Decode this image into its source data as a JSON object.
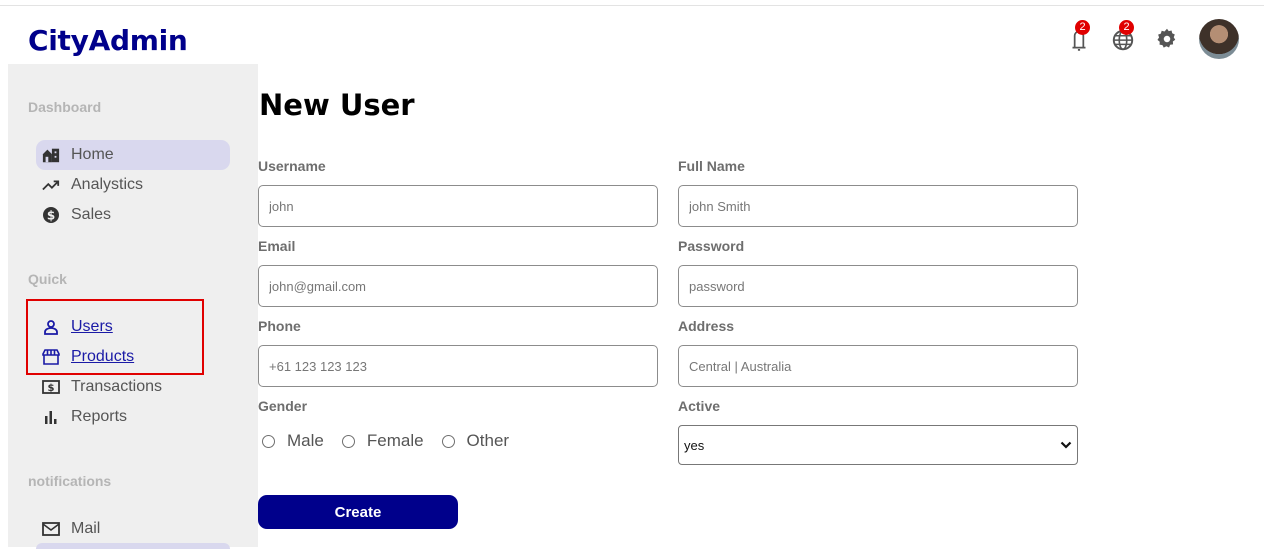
{
  "app": {
    "logo": "CityAdmin"
  },
  "topbar": {
    "notifications_badge": "2",
    "language_badge": "2"
  },
  "sidebar": {
    "sections": [
      {
        "title": "Dashboard",
        "items": [
          {
            "label": "Home",
            "icon": "home-icon",
            "active": true
          },
          {
            "label": "Analystics",
            "icon": "trending-up-icon"
          },
          {
            "label": "Sales",
            "icon": "dollar-circle-icon"
          }
        ]
      },
      {
        "title": "Quick",
        "items": [
          {
            "label": "Users",
            "icon": "user-icon",
            "link": true
          },
          {
            "label": "Products",
            "icon": "storefront-icon",
            "link": true
          },
          {
            "label": "Transactions",
            "icon": "money-icon"
          },
          {
            "label": "Reports",
            "icon": "bar-chart-icon"
          }
        ]
      },
      {
        "title": "notifications",
        "items": [
          {
            "label": "Mail",
            "icon": "mail-icon"
          }
        ]
      }
    ]
  },
  "form": {
    "title": "New User",
    "fields": {
      "username": {
        "label": "Username",
        "placeholder": "john"
      },
      "fullname": {
        "label": "Full Name",
        "placeholder": "john Smith"
      },
      "email": {
        "label": "Email",
        "placeholder": "john@gmail.com"
      },
      "password": {
        "label": "Password",
        "placeholder": "password"
      },
      "phone": {
        "label": "Phone",
        "placeholder": "+61 123 123 123"
      },
      "address": {
        "label": "Address",
        "placeholder": "Central | Australia"
      }
    },
    "gender": {
      "label": "Gender",
      "options": [
        "Male",
        "Female",
        "Other"
      ]
    },
    "active": {
      "label": "Active",
      "value": "yes"
    },
    "submit_label": "Create"
  },
  "colors": {
    "brand": "#00008b",
    "highlight": "#e00000",
    "active_nav": "#d9d8ee"
  }
}
